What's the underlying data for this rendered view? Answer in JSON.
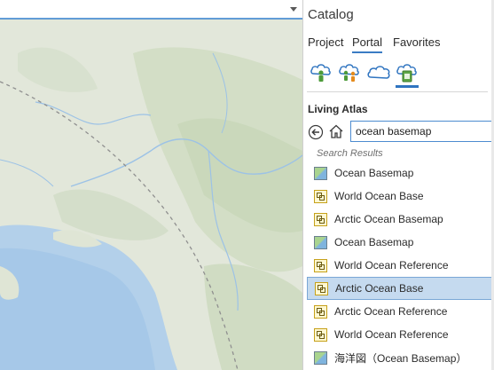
{
  "catalog": {
    "title": "Catalog",
    "tabs": [
      {
        "label": "Project",
        "active": false
      },
      {
        "label": "Portal",
        "active": true
      },
      {
        "label": "Favorites",
        "active": false
      }
    ],
    "source_icons": [
      "my-content-icon",
      "groups-icon",
      "all-portal-icon",
      "living-atlas-icon"
    ],
    "section_title": "Living Atlas",
    "search": {
      "value": "ocean basemap"
    },
    "results_title": "Search Results",
    "results": [
      {
        "label": "Ocean Basemap",
        "icon": "map-icon",
        "selected": false
      },
      {
        "label": "World Ocean Base",
        "icon": "layer-package-icon",
        "selected": false
      },
      {
        "label": "Arctic Ocean Basemap",
        "icon": "map-icon",
        "selected": false
      },
      {
        "label": "Ocean Basemap",
        "icon": "map-icon",
        "selected": false
      },
      {
        "label": "World Ocean Reference",
        "icon": "layer-package-icon",
        "selected": false
      },
      {
        "label": "Arctic Ocean Base",
        "icon": "layer-package-icon",
        "selected": true
      },
      {
        "label": "Arctic Ocean Reference",
        "icon": "layer-package-icon",
        "selected": false
      },
      {
        "label": "World Ocean Reference",
        "icon": "layer-package-icon",
        "selected": false
      },
      {
        "label": "海洋図（Ocean Basemap）",
        "icon": "map-icon",
        "selected": false
      }
    ]
  },
  "colors": {
    "accent": "#3b7cc4",
    "selection": "#c5daef",
    "land": "#dfe5d5",
    "water": "#a8cbea"
  }
}
